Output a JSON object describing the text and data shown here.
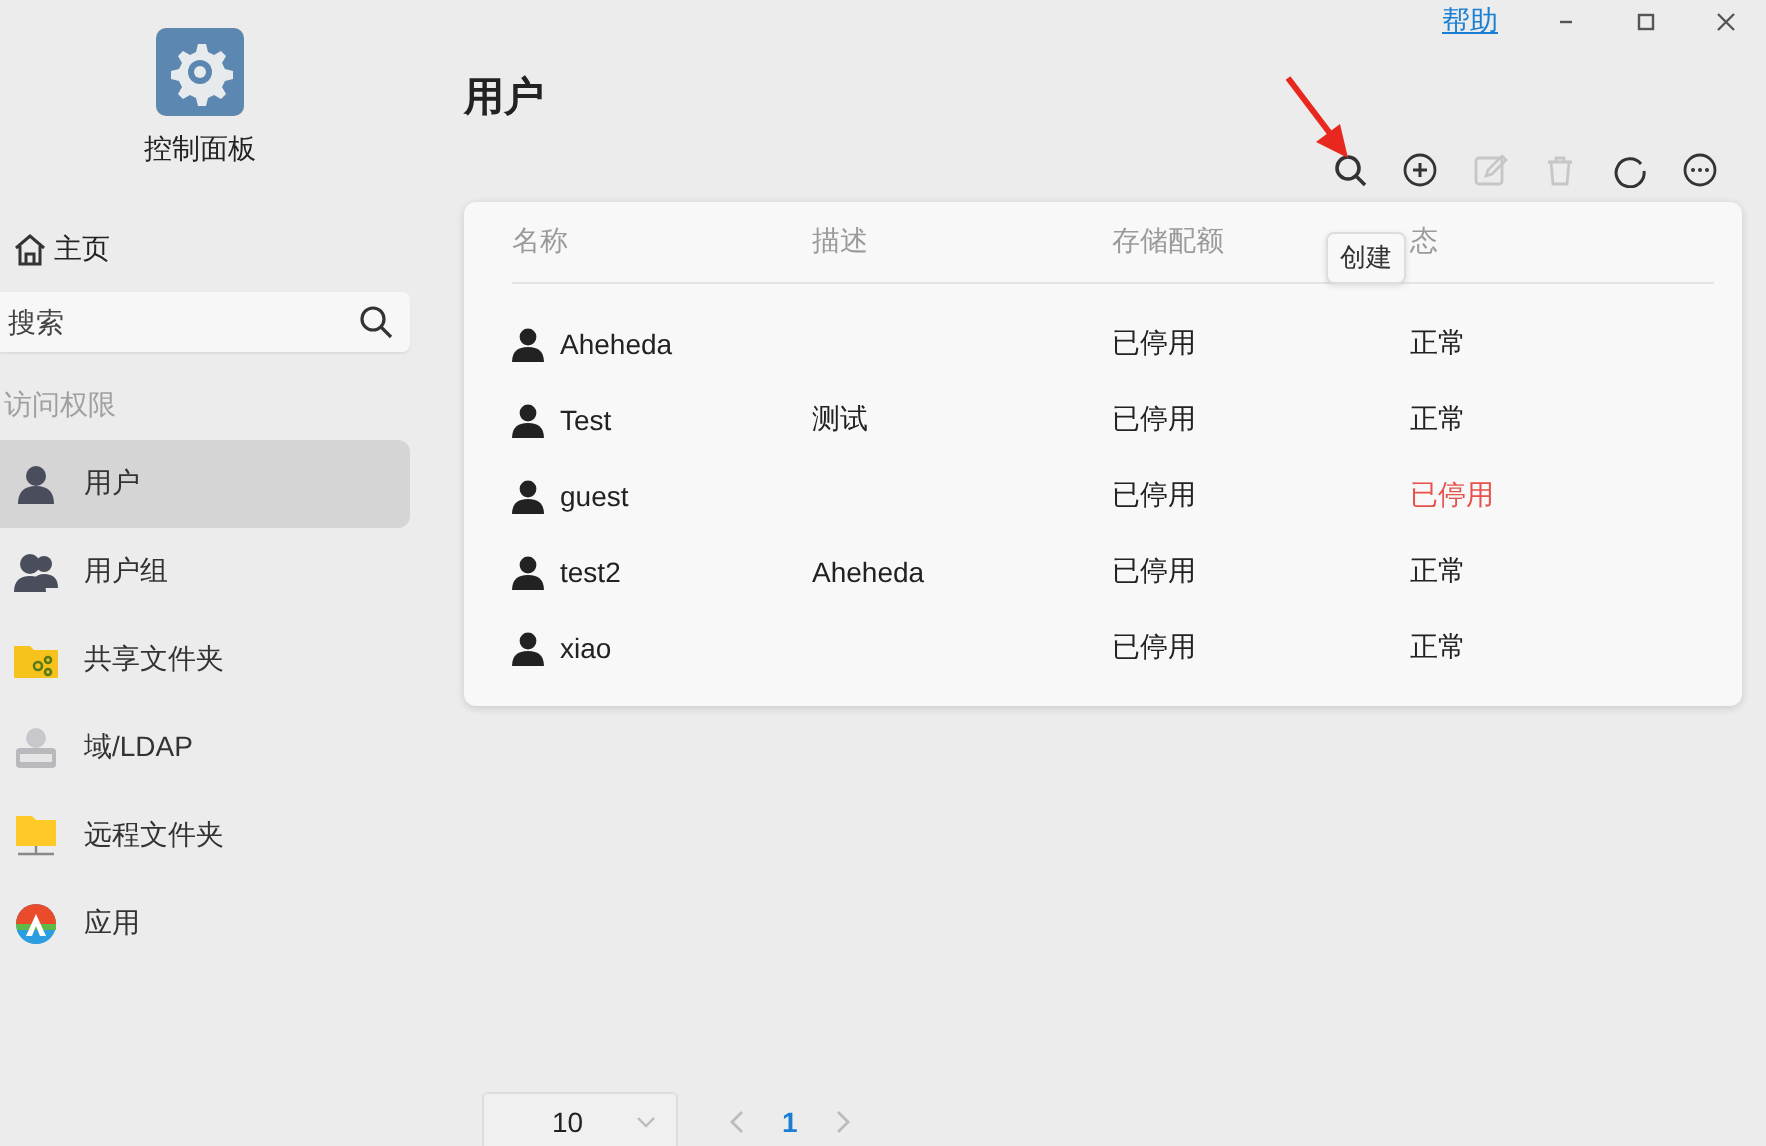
{
  "window": {
    "help_link": "帮助"
  },
  "sidebar": {
    "app_title": "控制面板",
    "home": "主页",
    "search": {
      "placeholder": "搜索"
    },
    "section": "访问权限",
    "items": [
      {
        "label": "用户",
        "kind": "user",
        "selected": true
      },
      {
        "label": "用户组",
        "kind": "group",
        "selected": false
      },
      {
        "label": "共享文件夹",
        "kind": "share-folder",
        "selected": false
      },
      {
        "label": "域/LDAP",
        "kind": "ldap",
        "selected": false
      },
      {
        "label": "远程文件夹",
        "kind": "remote-folder",
        "selected": false
      },
      {
        "label": "应用",
        "kind": "app",
        "selected": false
      }
    ]
  },
  "page": {
    "title": "用户",
    "toolbar": [
      {
        "kind": "search",
        "disabled": false
      },
      {
        "kind": "create",
        "disabled": false
      },
      {
        "kind": "edit",
        "disabled": true
      },
      {
        "kind": "delete",
        "disabled": true
      },
      {
        "kind": "refresh",
        "disabled": false
      },
      {
        "kind": "more",
        "disabled": false
      }
    ],
    "tooltip": "创建",
    "table": {
      "columns": [
        "名称",
        "描述",
        "存储配额",
        "态"
      ],
      "rows": [
        {
          "name": "Aheheda",
          "quota": "已停用",
          "status": "正常",
          "disabled": false
        },
        {
          "name": "Test",
          "description": "测试",
          "quota": "已停用",
          "status": "正常",
          "disabled": false
        },
        {
          "name": "guest",
          "quota": "已停用",
          "status": "已停用",
          "disabled": true
        },
        {
          "name": "test2",
          "description": "Aheheda",
          "quota": "已停用",
          "status": "正常",
          "disabled": false
        },
        {
          "name": "xiao",
          "quota": "已停用",
          "status": "正常",
          "disabled": false
        }
      ]
    },
    "pagination": {
      "page_size": "10",
      "current_page": "1"
    }
  }
}
